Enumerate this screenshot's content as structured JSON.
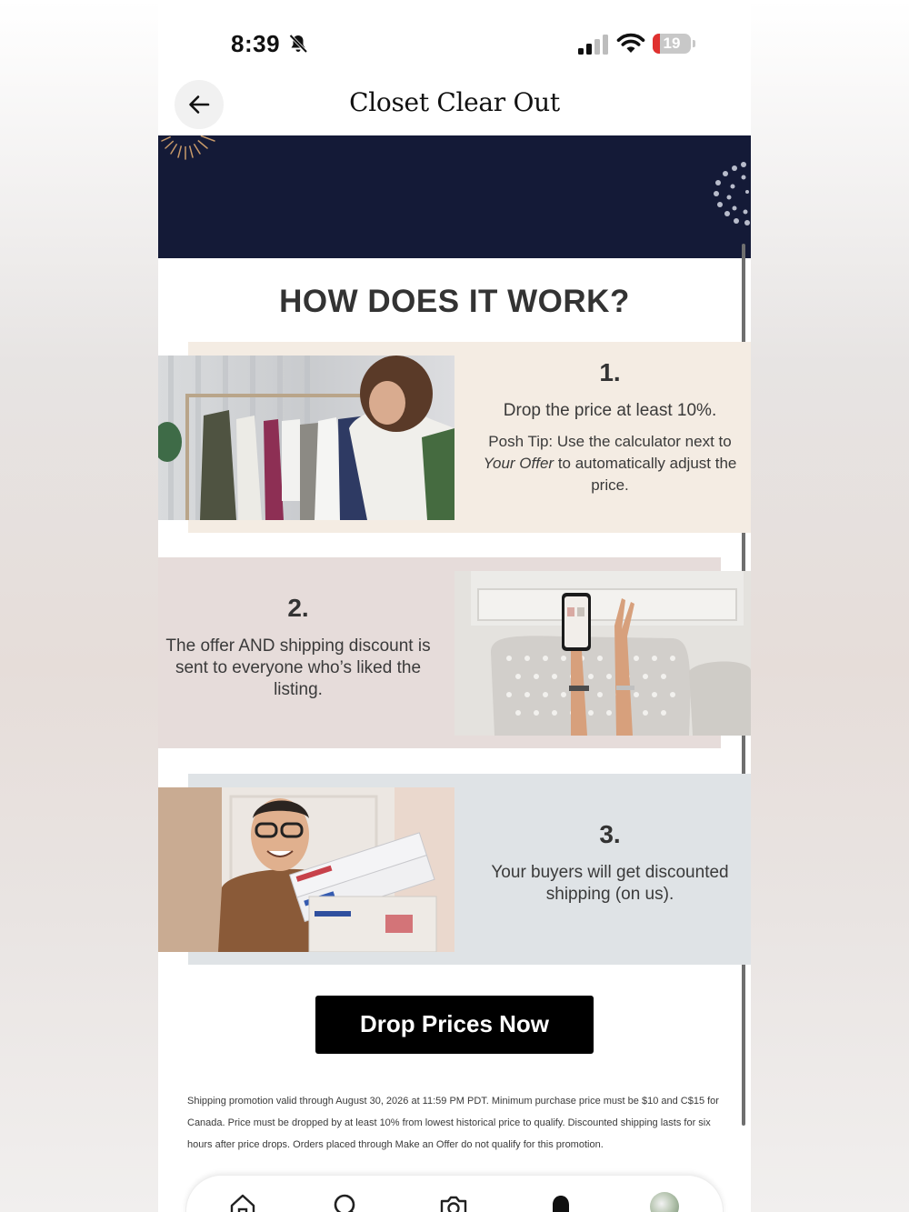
{
  "status_bar": {
    "time": "8:39",
    "battery_level": "19",
    "battery_fraction": 0.19
  },
  "header": {
    "title": "Closet Clear Out"
  },
  "section": {
    "heading": "HOW DOES IT WORK?"
  },
  "steps": [
    {
      "number": "1.",
      "text": "Drop the price at least 10%.",
      "tip_prefix": "Posh Tip: Use the calculator next to ",
      "tip_italic": "Your Offer",
      "tip_suffix": " to automatically adjust the price."
    },
    {
      "number": "2.",
      "text": "The offer AND shipping discount is sent to everyone who’s liked the listing."
    },
    {
      "number": "3.",
      "text": "Your buyers will get discounted shipping (on us)."
    }
  ],
  "cta": {
    "label": "Drop Prices Now"
  },
  "fine_print": "Shipping promotion valid through August 30, 2026 at 11:59 PM PDT. Minimum purchase price must be $10 and C$15 for Canada. Price must be dropped by at least 10% from lowest historical price to qualify. Discounted shipping lasts for six hours after price drops. Orders placed through Make an Offer do not qualify for this promotion.",
  "tab_bar": {
    "icons": [
      "home-icon",
      "search-icon",
      "camera-icon",
      "bell-icon",
      "profile-avatar"
    ]
  },
  "colors": {
    "banner": "#141a37",
    "step1_bg": "#f4ece3",
    "step2_bg": "#e6dcda",
    "step3_bg": "#dfe3e6",
    "cta_bg": "#000000"
  }
}
